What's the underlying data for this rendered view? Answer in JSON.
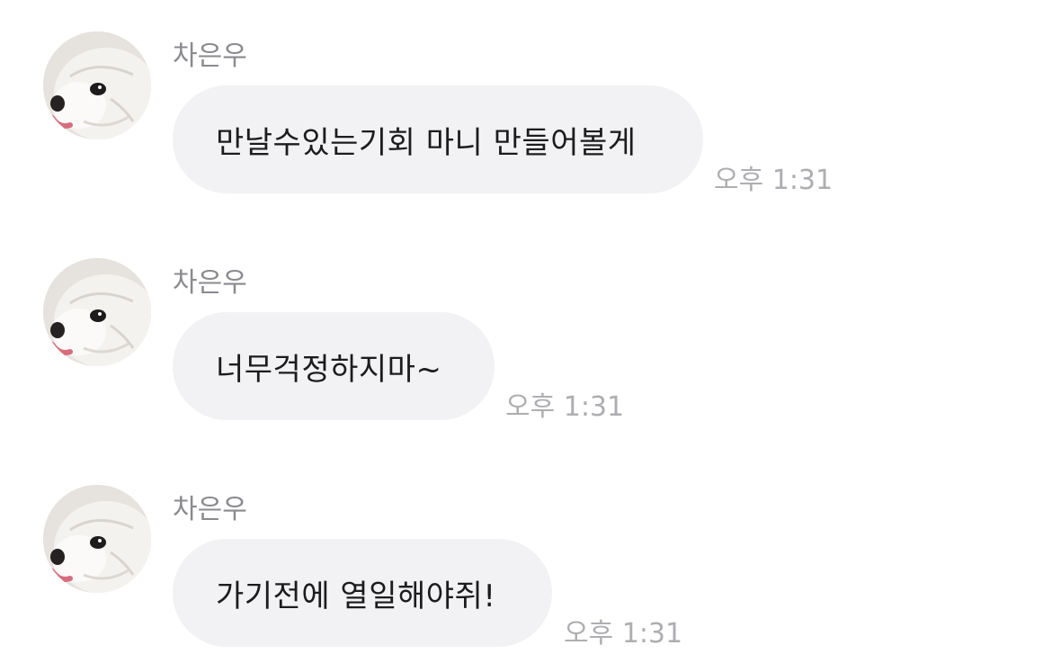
{
  "messages": [
    {
      "sender": "차은우",
      "text": "만날수있는기회 마니 만들어볼게",
      "time": "오후 1:31"
    },
    {
      "sender": "차은우",
      "text": "너무걱정하지마~",
      "time": "오후 1:31"
    },
    {
      "sender": "차은우",
      "text": "가기전에 열일해야쥐!",
      "time": "오후 1:31"
    }
  ],
  "colors": {
    "background": "#ffffff",
    "bubble": "#f2f2f4",
    "message_text": "#1c1c1e",
    "sender_text": "#8a8a8f",
    "timestamp_text": "#aeaeb2"
  },
  "avatar_icon": "dog-avatar-icon"
}
